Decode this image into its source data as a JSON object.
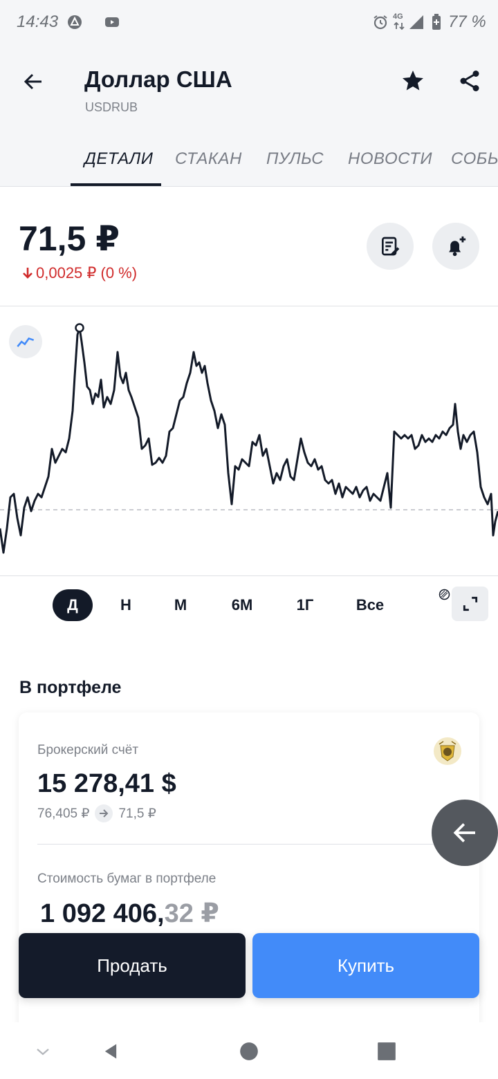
{
  "status_bar": {
    "time": "14:43",
    "network": "4G",
    "battery_percent": "77 %",
    "icons": [
      "autofill-icon",
      "youtube-icon",
      "alarm-icon",
      "network-4g-icon",
      "signal-icon",
      "battery-icon"
    ]
  },
  "header": {
    "title": "Доллар США",
    "ticker": "USDRUB",
    "tabs": [
      {
        "label": "ДЕТАЛИ",
        "active": true
      },
      {
        "label": "СТАКАН",
        "active": false
      },
      {
        "label": "ПУЛЬС",
        "active": false
      },
      {
        "label": "НОВОСТИ",
        "active": false
      },
      {
        "label": "СОБЫ",
        "active": false
      }
    ]
  },
  "quote": {
    "price": "71,5 ₽",
    "change": "0,0025 ₽ (0 %)",
    "change_direction": "down",
    "change_color": "#d02a2a"
  },
  "chart": {
    "periods": [
      {
        "label": "Д",
        "active": true
      },
      {
        "label": "Н",
        "active": false
      },
      {
        "label": "М",
        "active": false
      },
      {
        "label": "6М",
        "active": false
      },
      {
        "label": "1Г",
        "active": false
      },
      {
        "label": "Все",
        "active": false
      }
    ],
    "line_color": "#131a28"
  },
  "portfolio": {
    "section_title": "В портфеле",
    "account_label": "Брокерский счёт",
    "account_value": "15 278,41 $",
    "rate_from": "76,405 ₽",
    "rate_to": "71,5 ₽",
    "securities_label": "Стоимость бумаг в портфеле",
    "securities_value_main": "1 092 406,",
    "securities_value_fraction": "32 ₽"
  },
  "actions": {
    "sell": "Продать",
    "buy": "Купить",
    "sell_color": "#141b2a",
    "buy_color": "#428bf9"
  }
}
